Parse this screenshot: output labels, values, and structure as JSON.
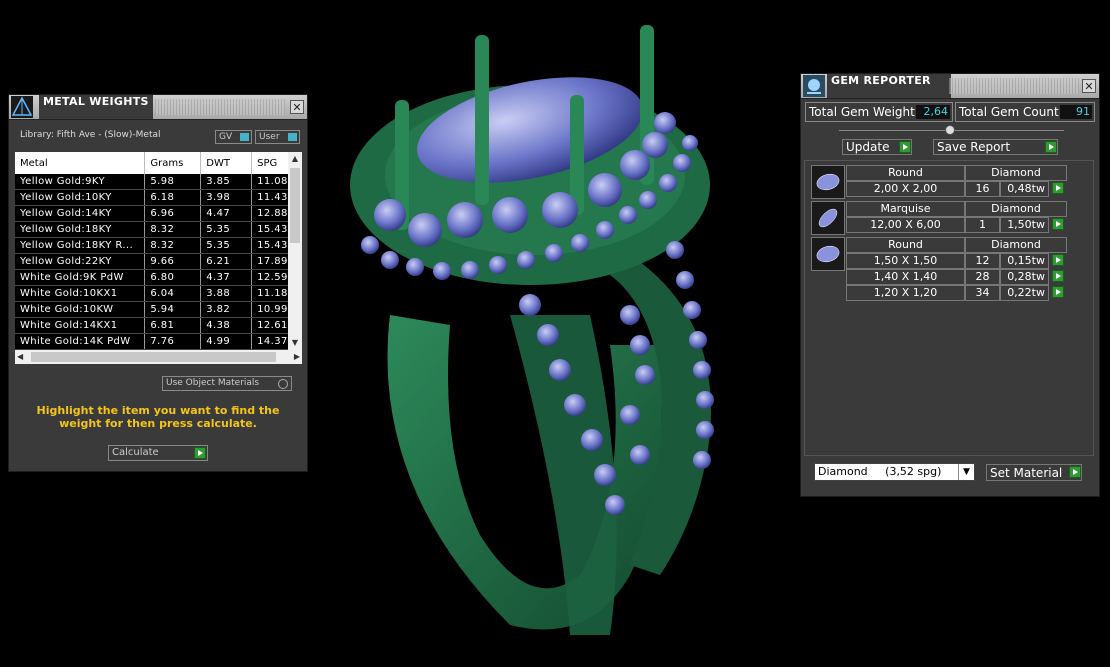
{
  "metal_panel": {
    "title": "METAL WEIGHTS",
    "close": "✕",
    "library": "Library: Fifth Ave - (Slow)-Metal",
    "toggle_gv": "GV",
    "toggle_user": "User",
    "columns": [
      "Metal",
      "Grams",
      "DWT",
      "SPG"
    ],
    "rows": [
      [
        "Yellow Gold:9KY",
        "5.98",
        "3.85",
        "11.08"
      ],
      [
        "Yellow Gold:10KY",
        "6.18",
        "3.98",
        "11.43"
      ],
      [
        "Yellow Gold:14KY",
        "6.96",
        "4.47",
        "12.88"
      ],
      [
        "Yellow Gold:18KY",
        "8.32",
        "5.35",
        "15.43"
      ],
      [
        "Yellow Gold:18KY R...",
        "8.32",
        "5.35",
        "15.43"
      ],
      [
        "Yellow Gold:22KY",
        "9.66",
        "6.21",
        "17.89"
      ],
      [
        "White Gold:9K PdW",
        "6.80",
        "4.37",
        "12.59"
      ],
      [
        "White Gold:10KX1",
        "6.04",
        "3.88",
        "11.18"
      ],
      [
        "White Gold:10KW",
        "5.94",
        "3.82",
        "10.99"
      ],
      [
        "White Gold:14KX1",
        "6.81",
        "4.38",
        "12.61"
      ],
      [
        "White Gold:14K PdW",
        "7.76",
        "4.99",
        "14.37"
      ]
    ],
    "use_object_materials": "Use Object Materials",
    "message": "Highlight the item you want to find the weight for then press calculate.",
    "calculate": "Calculate"
  },
  "gem_panel": {
    "title": "GEM REPORTER",
    "close": "✕",
    "total_weight_label": "Total Gem Weight",
    "total_weight_value": "2,64",
    "total_count_label": "Total Gem Count",
    "total_count_value": "91",
    "update": "Update",
    "save_report": "Save Report",
    "groups": [
      {
        "shape": "Round",
        "material": "Diamond",
        "rows": [
          {
            "size": "2,00 X 2,00",
            "count": "16",
            "tw": "0,48tw"
          }
        ]
      },
      {
        "shape": "Marquise",
        "material": "Diamond",
        "rows": [
          {
            "size": "12,00 X 6,00",
            "count": "1",
            "tw": "1,50tw"
          }
        ]
      },
      {
        "shape": "Round",
        "material": "Diamond",
        "rows": [
          {
            "size": "1,50 X 1,50",
            "count": "12",
            "tw": "0,15tw"
          },
          {
            "size": "1,40 X 1,40",
            "count": "28",
            "tw": "0,28tw"
          },
          {
            "size": "1,20 X 1,20",
            "count": "34",
            "tw": "0,22tw"
          }
        ]
      }
    ],
    "material_select": "Diamond     (3,52 spg)",
    "set_material": "Set Material"
  },
  "colors": {
    "ring_green": "#1f6b45",
    "gem_blue": "#5560b8",
    "accent_teal": "#47b3c8",
    "message_yellow": "#f5c518",
    "button_green": "#2e9b33"
  }
}
